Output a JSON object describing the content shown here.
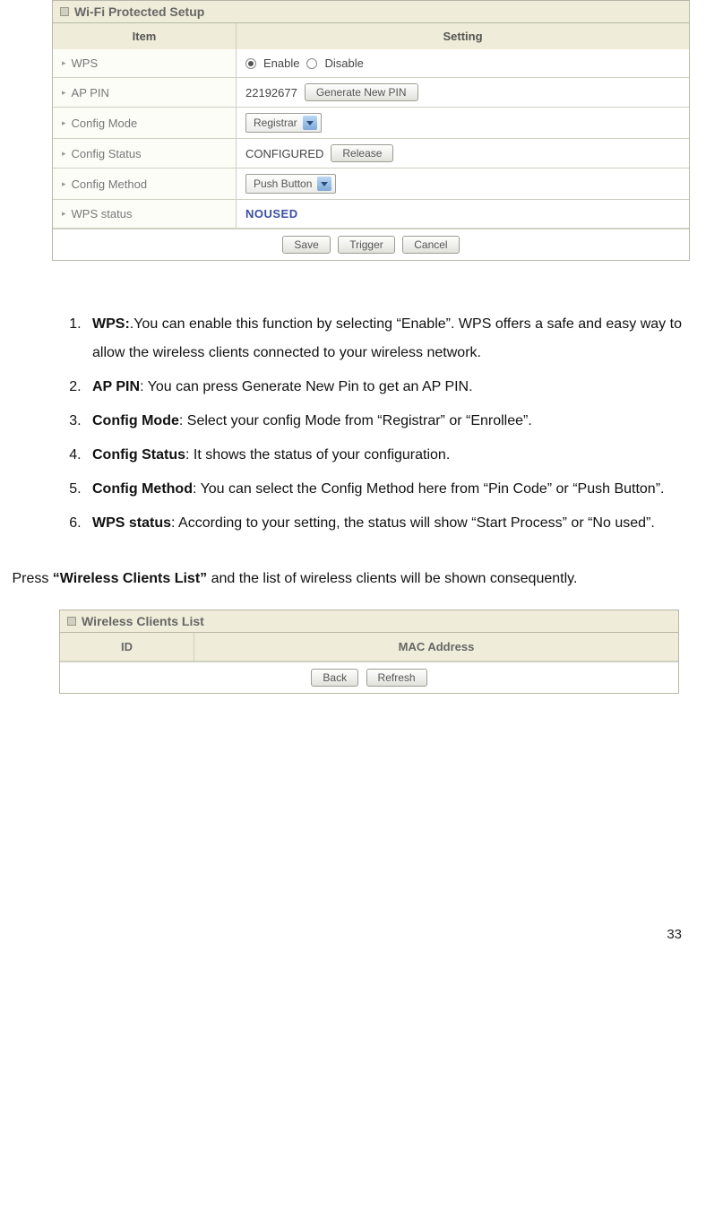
{
  "panel1": {
    "title": "Wi-Fi Protected Setup",
    "head_item": "Item",
    "head_setting": "Setting",
    "rows": {
      "wps": {
        "label": "WPS",
        "opt_enable": "Enable",
        "opt_disable": "Disable"
      },
      "appin": {
        "label": "AP PIN",
        "value": "22192677",
        "button": "Generate New PIN"
      },
      "config_mode": {
        "label": "Config Mode",
        "value": "Registrar"
      },
      "config_status": {
        "label": "Config Status",
        "value": "CONFIGURED",
        "button": "Release"
      },
      "config_method": {
        "label": "Config Method",
        "value": "Push Button"
      },
      "wps_status": {
        "label": "WPS status",
        "value": "NOUSED"
      }
    },
    "footer": {
      "save": "Save",
      "trigger": "Trigger",
      "cancel": "Cancel"
    }
  },
  "list": {
    "n1": "1.",
    "n2": "2.",
    "n3": "3.",
    "n4": "4.",
    "n5": "5.",
    "n6": "6.",
    "i1_b": "WPS:",
    "i1_t": ".You can enable this function by selecting “Enable”. WPS offers a safe and easy way to allow the wireless clients connected to your wireless network.",
    "i2_b": "AP PIN",
    "i2_t": ": You can press Generate New Pin to get an AP PIN.",
    "i3_b": "Config Mode",
    "i3_t": ": Select your config Mode from “Registrar” or “Enrollee”.",
    "i4_b": "Config Status",
    "i4_t": ": It shows the status of your configuration.",
    "i5_b": "Config Method",
    "i5_t": ": You can select the Config Method here from “Pin Code” or “Push Button”.",
    "i6_b": "WPS status",
    "i6_t": ": According to your setting, the status will show “Start Process” or “No used”."
  },
  "para": {
    "pre": " Press ",
    "bold": "“Wireless Clients List”",
    "post": " and the list of wireless clients will be shown consequently."
  },
  "panel2": {
    "title": "Wireless Clients List",
    "head_id": "ID",
    "head_mac": "MAC Address",
    "footer": {
      "back": "Back",
      "refresh": "Refresh"
    }
  },
  "page_number": "33"
}
